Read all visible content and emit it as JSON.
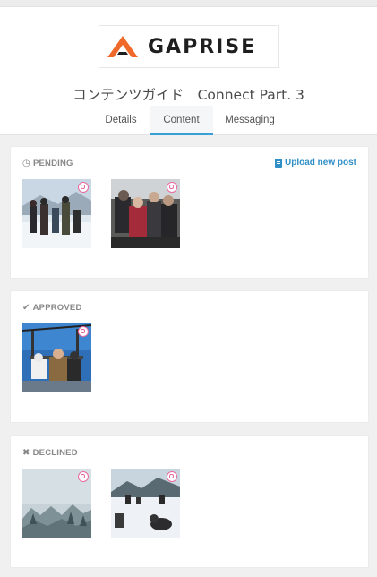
{
  "header": {
    "logo_text": "GAPRISE",
    "title": "コンテンツガイド　Connect Part. 3",
    "tabs": [
      {
        "label": "Details",
        "active": false
      },
      {
        "label": "Content",
        "active": true
      },
      {
        "label": "Messaging",
        "active": false
      }
    ]
  },
  "sections": {
    "pending": {
      "label": "PENDING",
      "icon": "clock-icon",
      "action_label": "Upload new post",
      "posts": 2
    },
    "approved": {
      "label": "APPROVED",
      "icon": "checkmark-icon",
      "posts": 1
    },
    "declined": {
      "label": "DECLINED",
      "icon": "x-icon",
      "posts": 2
    }
  },
  "colors": {
    "accent": "#38a0d6",
    "link": "#2f8fc7",
    "logo_orange": "#ef6a2a",
    "instagram_badge": "#e86a9e"
  }
}
